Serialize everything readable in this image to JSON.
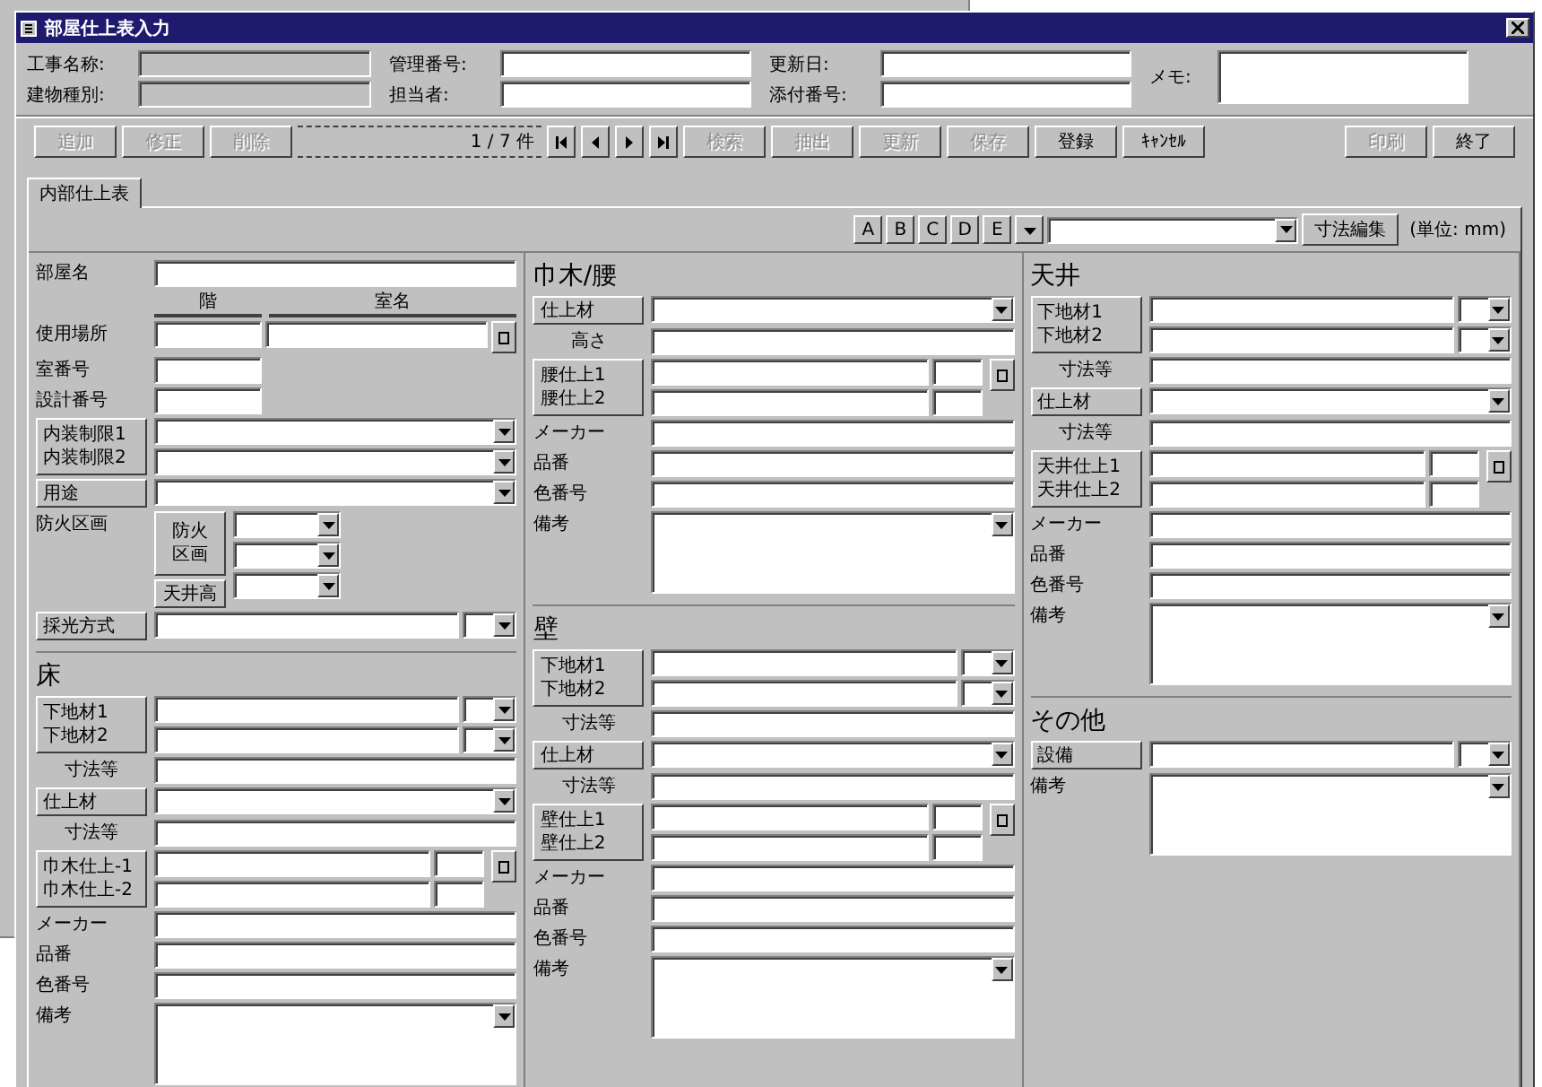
{
  "window": {
    "title": "部屋仕上表入力"
  },
  "header": {
    "columns": [
      {
        "fields": [
          {
            "label": "工事名称:",
            "kind": "readonly"
          },
          {
            "label": "建物種別:",
            "kind": "readonly"
          }
        ]
      },
      {
        "fields": [
          {
            "label": "管理番号:",
            "kind": "input"
          },
          {
            "label": "担当者:",
            "kind": "input"
          }
        ]
      },
      {
        "fields": [
          {
            "label": "更新日:",
            "kind": "input"
          },
          {
            "label": "添付番号:",
            "kind": "input"
          }
        ]
      },
      {
        "fields": [
          {
            "label": "メモ:",
            "kind": "memo"
          }
        ]
      }
    ]
  },
  "toolbar": {
    "buttons": [
      {
        "kind": "button",
        "label": "追加",
        "disabled": true
      },
      {
        "kind": "button",
        "label": "修正",
        "disabled": true
      },
      {
        "kind": "button",
        "label": "削除",
        "disabled": true
      },
      {
        "kind": "record",
        "label": "1 / 7 件"
      },
      {
        "kind": "first"
      },
      {
        "kind": "prev"
      },
      {
        "kind": "next"
      },
      {
        "kind": "last"
      },
      {
        "kind": "button",
        "label": "検索",
        "disabled": true
      },
      {
        "kind": "button",
        "label": "抽出",
        "disabled": true
      },
      {
        "kind": "button",
        "label": "更新",
        "disabled": true
      },
      {
        "kind": "button",
        "label": "保存",
        "disabled": true
      },
      {
        "kind": "button",
        "label": "登録",
        "disabled": false
      },
      {
        "kind": "button",
        "label": "ｷｬﾝｾﾙ",
        "disabled": false
      },
      {
        "kind": "spacer"
      },
      {
        "kind": "button",
        "label": "印刷",
        "disabled": true
      },
      {
        "kind": "button",
        "label": "終了",
        "disabled": false
      }
    ]
  },
  "tabs": [
    {
      "label": "内部仕上表",
      "selected": true
    }
  ],
  "tools": {
    "letters": [
      "A",
      "B",
      "C",
      "D",
      "E"
    ],
    "edit_button": "寸法編集",
    "unit": "(単位: mm)"
  },
  "columns": [
    {
      "sections": [
        {
          "rows": [
            {
              "kind": "text",
              "label": "部屋名",
              "fields": [
                {
                  "kind": "input"
                }
              ]
            },
            {
              "kind": "headers",
              "labels": [
                "階",
                "室名"
              ]
            },
            {
              "kind": "text",
              "label": "使用場所",
              "fields": [
                {
                  "kind": "mid"
                },
                {
                  "kind": "input"
                },
                {
                  "kind": "square"
                }
              ]
            },
            {
              "kind": "text",
              "label": "室番号",
              "fields": [
                {
                  "kind": "mid"
                }
              ]
            },
            {
              "kind": "text",
              "label": "設計番号",
              "fields": [
                {
                  "kind": "mid"
                }
              ]
            },
            {
              "kind": "pair",
              "labels": [
                "内装制限1",
                "内装制限2"
              ],
              "fields": [
                {
                  "kind": "combo"
                }
              ],
              "side": false
            },
            {
              "kind": "button",
              "label": "用途",
              "fields": [
                {
                  "kind": "combo"
                }
              ]
            },
            {
              "kind": "stack",
              "label": "防火区画",
              "buttons": [
                [
                  "防火",
                  "区画"
                ],
                [
                  "天井高"
                ]
              ],
              "fields": [
                {
                  "kind": "unit-combo"
                },
                {
                  "kind": "unit-combo"
                },
                {
                  "kind": "unit-combo"
                }
              ]
            },
            {
              "kind": "button",
              "label": "採光方式",
              "fields": [
                {
                  "kind": "input"
                },
                {
                  "kind": "unit-combo"
                }
              ]
            }
          ]
        },
        {
          "title": "床",
          "rows": [
            {
              "kind": "pair",
              "labels": [
                "下地材1",
                "下地材2"
              ],
              "fields": [
                {
                  "kind": "input"
                },
                {
                  "kind": "unit-combo"
                }
              ],
              "side": false
            },
            {
              "kind": "sub",
              "label": "寸法等",
              "fields": [
                {
                  "kind": "input"
                }
              ]
            },
            {
              "kind": "button",
              "label": "仕上材",
              "fields": [
                {
                  "kind": "combo"
                }
              ]
            },
            {
              "kind": "sub",
              "label": "寸法等",
              "fields": [
                {
                  "kind": "input"
                }
              ]
            },
            {
              "kind": "pair",
              "labels": [
                "巾木仕上-1",
                "巾木仕上-2"
              ],
              "fields": [
                {
                  "kind": "input"
                },
                {
                  "kind": "unit"
                }
              ],
              "side": true
            },
            {
              "kind": "text",
              "label": "メーカー",
              "fields": [
                {
                  "kind": "input"
                }
              ]
            },
            {
              "kind": "text",
              "label": "品番",
              "fields": [
                {
                  "kind": "input"
                }
              ]
            },
            {
              "kind": "text",
              "label": "色番号",
              "fields": [
                {
                  "kind": "input"
                }
              ]
            },
            {
              "kind": "text",
              "label": "備考",
              "fields": [
                {
                  "kind": "memo"
                }
              ]
            }
          ]
        }
      ]
    },
    {
      "sections": [
        {
          "title": "巾木/腰",
          "rows": [
            {
              "kind": "button",
              "label": "仕上材",
              "fields": [
                {
                  "kind": "combo"
                }
              ]
            },
            {
              "kind": "sub",
              "label": "高さ",
              "fields": [
                {
                  "kind": "input"
                }
              ]
            },
            {
              "kind": "pair",
              "labels": [
                "腰仕上1",
                "腰仕上2"
              ],
              "fields": [
                {
                  "kind": "input"
                },
                {
                  "kind": "unit"
                }
              ],
              "side": true
            },
            {
              "kind": "text",
              "label": "メーカー",
              "fields": [
                {
                  "kind": "input"
                }
              ]
            },
            {
              "kind": "text",
              "label": "品番",
              "fields": [
                {
                  "kind": "input"
                }
              ]
            },
            {
              "kind": "text",
              "label": "色番号",
              "fields": [
                {
                  "kind": "input"
                }
              ]
            },
            {
              "kind": "text",
              "label": "備考",
              "fields": [
                {
                  "kind": "memo"
                }
              ]
            }
          ]
        },
        {
          "title": "壁",
          "rows": [
            {
              "kind": "pair",
              "labels": [
                "下地材1",
                "下地材2"
              ],
              "fields": [
                {
                  "kind": "input"
                },
                {
                  "kind": "unit-combo"
                }
              ],
              "side": false
            },
            {
              "kind": "sub",
              "label": "寸法等",
              "fields": [
                {
                  "kind": "input"
                }
              ]
            },
            {
              "kind": "button",
              "label": "仕上材",
              "fields": [
                {
                  "kind": "combo"
                }
              ]
            },
            {
              "kind": "sub",
              "label": "寸法等",
              "fields": [
                {
                  "kind": "input"
                }
              ]
            },
            {
              "kind": "pair",
              "labels": [
                "壁仕上1",
                "壁仕上2"
              ],
              "fields": [
                {
                  "kind": "input"
                },
                {
                  "kind": "unit"
                }
              ],
              "side": true
            },
            {
              "kind": "text",
              "label": "メーカー",
              "fields": [
                {
                  "kind": "input"
                }
              ]
            },
            {
              "kind": "text",
              "label": "品番",
              "fields": [
                {
                  "kind": "input"
                }
              ]
            },
            {
              "kind": "text",
              "label": "色番号",
              "fields": [
                {
                  "kind": "input"
                }
              ]
            },
            {
              "kind": "text",
              "label": "備考",
              "fields": [
                {
                  "kind": "memo"
                }
              ]
            }
          ]
        }
      ]
    },
    {
      "sections": [
        {
          "title": "天井",
          "rows": [
            {
              "kind": "pair",
              "labels": [
                "下地材1",
                "下地材2"
              ],
              "fields": [
                {
                  "kind": "input"
                },
                {
                  "kind": "unit-combo"
                }
              ],
              "side": false
            },
            {
              "kind": "sub",
              "label": "寸法等",
              "fields": [
                {
                  "kind": "input"
                }
              ]
            },
            {
              "kind": "button",
              "label": "仕上材",
              "fields": [
                {
                  "kind": "combo"
                }
              ]
            },
            {
              "kind": "sub",
              "label": "寸法等",
              "fields": [
                {
                  "kind": "input"
                }
              ]
            },
            {
              "kind": "pair",
              "labels": [
                "天井仕上1",
                "天井仕上2"
              ],
              "fields": [
                {
                  "kind": "input"
                },
                {
                  "kind": "unit"
                }
              ],
              "side": true
            },
            {
              "kind": "text",
              "label": "メーカー",
              "fields": [
                {
                  "kind": "input"
                }
              ]
            },
            {
              "kind": "text",
              "label": "品番",
              "fields": [
                {
                  "kind": "input"
                }
              ]
            },
            {
              "kind": "text",
              "label": "色番号",
              "fields": [
                {
                  "kind": "input"
                }
              ]
            },
            {
              "kind": "text",
              "label": "備考",
              "fields": [
                {
                  "kind": "memo"
                }
              ]
            }
          ]
        },
        {
          "title": "その他",
          "rows": [
            {
              "kind": "button",
              "label": "設備",
              "fields": [
                {
                  "kind": "input"
                },
                {
                  "kind": "unit-combo"
                }
              ]
            },
            {
              "kind": "text",
              "label": "備考",
              "fields": [
                {
                  "kind": "memo"
                }
              ]
            }
          ]
        }
      ]
    }
  ]
}
